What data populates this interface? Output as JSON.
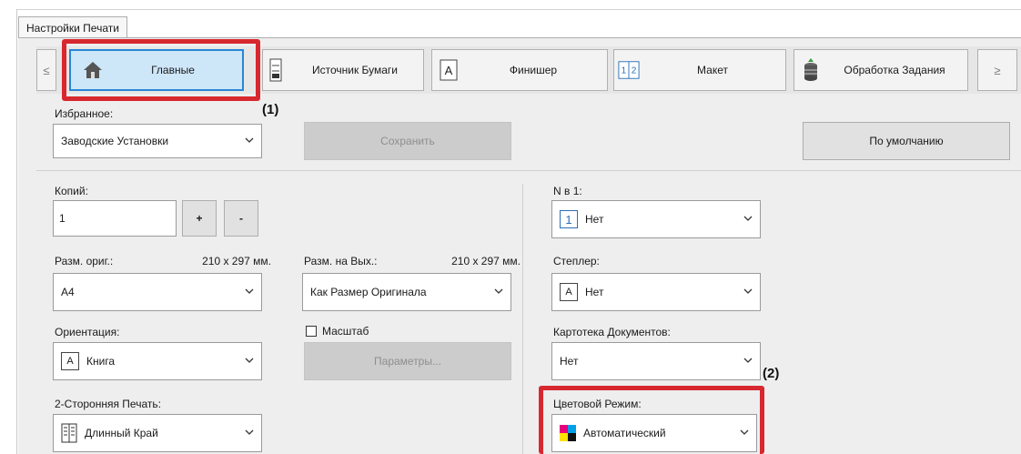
{
  "window": {
    "tab_title": "Настройки Печати"
  },
  "ribbon": {
    "prev_label": "≤",
    "next_label": "≥",
    "tabs": [
      {
        "label": "Главные",
        "icon": "home-icon"
      },
      {
        "label": "Источник Бумаги",
        "icon": "paper-source-icon"
      },
      {
        "label": "Финишер",
        "icon": "finisher-icon"
      },
      {
        "label": "Макет",
        "icon": "layout-icon"
      },
      {
        "label": "Обработка Задания",
        "icon": "job-handling-icon"
      }
    ]
  },
  "favorites": {
    "label": "Избранное:",
    "value": "Заводские Установки",
    "save_label": "Сохранить",
    "default_label": "По умолчанию"
  },
  "copies": {
    "label": "Копий:",
    "value": "1",
    "plus": "+",
    "minus": "-"
  },
  "orig_size": {
    "label": "Разм. ориг.:",
    "dims": "210 x 297 мм.",
    "value": "A4"
  },
  "output_size": {
    "label": "Разм. на Вых.:",
    "dims": "210 x 297 мм.",
    "value": "Как Размер Оригинала"
  },
  "orientation": {
    "label": "Ориентация:",
    "icon_letter": "A",
    "value": "Книга"
  },
  "zoom": {
    "label": "Масштаб",
    "params_label": "Параметры..."
  },
  "duplex": {
    "label": "2-Сторонняя Печать:",
    "value": "Длинный Край"
  },
  "n_up": {
    "label": "N в 1:",
    "icon_letter": "1",
    "value": "Нет"
  },
  "stapler": {
    "label": "Степлер:",
    "icon_letter": "A",
    "value": "Нет"
  },
  "doc_filing": {
    "label": "Картотека Документов:",
    "value": "Нет"
  },
  "color_mode": {
    "label": "Цветовой Режим:",
    "value": "Автоматический"
  },
  "callouts": {
    "one": "(1)",
    "two": "(2)"
  },
  "colors": {
    "highlight": "#d7282f",
    "active_tab": "#cde6f8",
    "accent": "#2a86d6"
  }
}
